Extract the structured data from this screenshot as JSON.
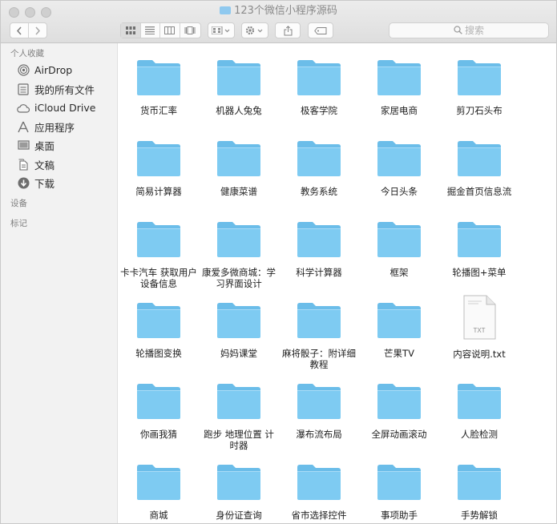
{
  "window": {
    "title": "123个微信小程序源码"
  },
  "toolbar": {
    "back_icon": "chevron-left-icon",
    "forward_icon": "chevron-right-icon",
    "search_placeholder": "搜索"
  },
  "sidebar": {
    "favorites_title": "个人收藏",
    "items": [
      {
        "label": "AirDrop",
        "icon": "airdrop-icon"
      },
      {
        "label": "我的所有文件",
        "icon": "all-files-icon"
      },
      {
        "label": "iCloud Drive",
        "icon": "cloud-icon"
      },
      {
        "label": "应用程序",
        "icon": "applications-icon"
      },
      {
        "label": "桌面",
        "icon": "desktop-icon"
      },
      {
        "label": "文稿",
        "icon": "documents-icon"
      },
      {
        "label": "下载",
        "icon": "download-icon"
      }
    ],
    "devices_title": "设备",
    "tags_title": "标记"
  },
  "files": [
    {
      "name": "货币汇率",
      "kind": "folder"
    },
    {
      "name": "机器人兔兔",
      "kind": "folder"
    },
    {
      "name": "极客学院",
      "kind": "folder"
    },
    {
      "name": "家居电商",
      "kind": "folder"
    },
    {
      "name": "剪刀石头布",
      "kind": "folder"
    },
    {
      "name": "简易计算器",
      "kind": "folder"
    },
    {
      "name": "健康菜谱",
      "kind": "folder"
    },
    {
      "name": "教务系统",
      "kind": "folder"
    },
    {
      "name": "今日头条",
      "kind": "folder"
    },
    {
      "name": "掘金首页信息流",
      "kind": "folder"
    },
    {
      "name": "卡卡汽车 获取用户设备信息",
      "kind": "folder"
    },
    {
      "name": "康爱多微商城：学习界面设计",
      "kind": "folder"
    },
    {
      "name": "科学计算器",
      "kind": "folder"
    },
    {
      "name": "框架",
      "kind": "folder"
    },
    {
      "name": "轮播图+菜单",
      "kind": "folder"
    },
    {
      "name": "轮播图变换",
      "kind": "folder"
    },
    {
      "name": "妈妈课堂",
      "kind": "folder"
    },
    {
      "name": "麻将骰子：附详细教程",
      "kind": "folder"
    },
    {
      "name": "芒果TV",
      "kind": "folder"
    },
    {
      "name": "内容说明.txt",
      "kind": "txt",
      "badge": "TXT"
    },
    {
      "name": "你画我猜",
      "kind": "folder"
    },
    {
      "name": "跑步 地理位置 计时器",
      "kind": "folder"
    },
    {
      "name": "瀑布流布局",
      "kind": "folder"
    },
    {
      "name": "全屏动画滚动",
      "kind": "folder"
    },
    {
      "name": "人脸检测",
      "kind": "folder"
    },
    {
      "name": "商城",
      "kind": "folder"
    },
    {
      "name": "身份证查询",
      "kind": "folder"
    },
    {
      "name": "省市选择控件",
      "kind": "folder"
    },
    {
      "name": "事项助手",
      "kind": "folder"
    },
    {
      "name": "手势解锁",
      "kind": "folder"
    }
  ],
  "colors": {
    "folder_body": "#7ecbf2",
    "folder_tab": "#6bbde9",
    "sidebar_bg": "#f2f2f2"
  }
}
